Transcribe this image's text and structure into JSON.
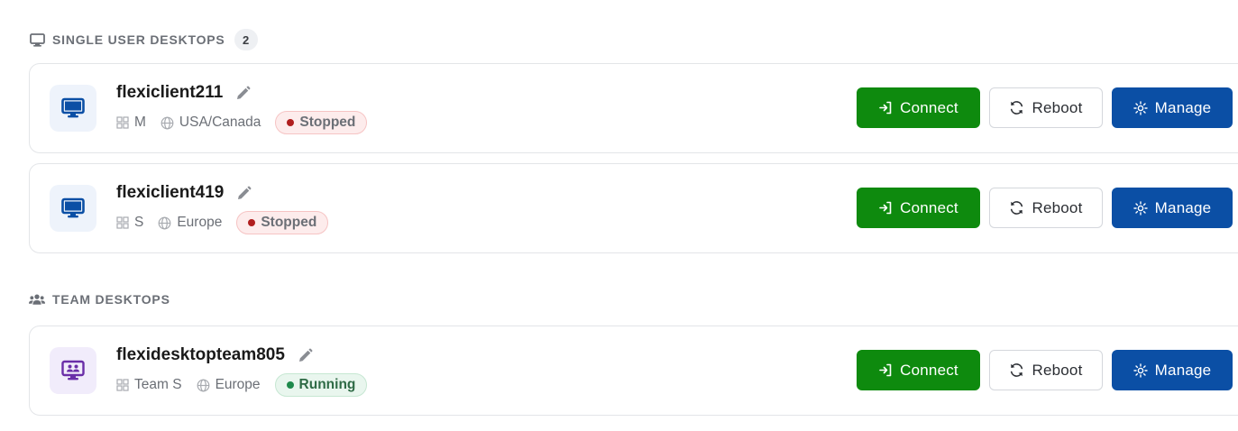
{
  "sections": {
    "single": {
      "title": "SINGLE USER DESKTOPS",
      "count": "2"
    },
    "team": {
      "title": "TEAM DESKTOPS"
    }
  },
  "desktops": [
    {
      "name": "flexiclient211",
      "size": "M",
      "region": "USA/Canada",
      "status": "Stopped",
      "type": "single"
    },
    {
      "name": "flexiclient419",
      "size": "S",
      "region": "Europe",
      "status": "Stopped",
      "type": "single"
    },
    {
      "name": "flexidesktopteam805",
      "size": "Team S",
      "region": "Europe",
      "status": "Running",
      "type": "team"
    }
  ],
  "actions": {
    "connect": "Connect",
    "reboot": "Reboot",
    "manage": "Manage"
  },
  "colors": {
    "connect": "#0e8a0e",
    "manage": "#0b4fa5",
    "stopped_dot": "#b01e1e",
    "running_dot": "#1f8a4c",
    "single_icon": "#0b4fa5",
    "team_icon": "#6a2ea8"
  },
  "icons": {
    "single_section": "monitor-icon",
    "team_section": "users-icon",
    "edit": "pencil-icon",
    "size": "grid-icon",
    "region": "globe-icon",
    "connect": "sign-in-icon",
    "reboot": "refresh-icon",
    "manage": "gear-icon"
  }
}
